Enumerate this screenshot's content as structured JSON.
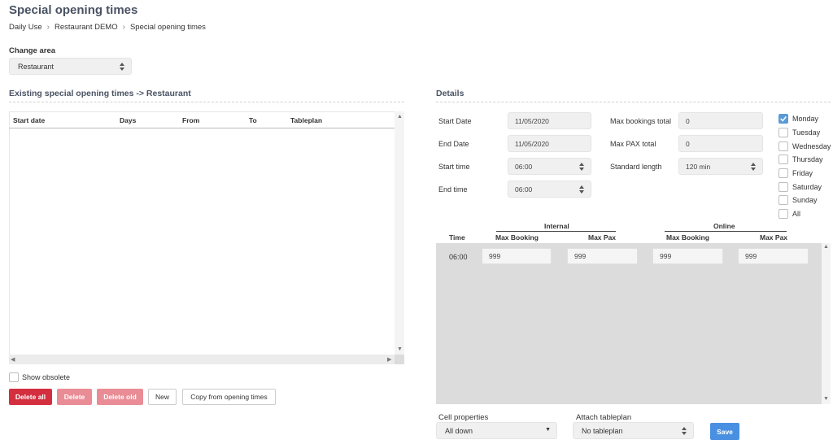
{
  "page_title": "Special opening times",
  "breadcrumb": [
    "Daily Use",
    "Restaurant DEMO",
    "Special opening times"
  ],
  "change_area": {
    "label": "Change area",
    "value": "Restaurant"
  },
  "existing": {
    "title": "Existing special opening times -> Restaurant",
    "columns": [
      "Start date",
      "Days",
      "From",
      "To",
      "Tableplan"
    ],
    "rows": [],
    "show_obsolete_label": "Show obsolete",
    "show_obsolete_checked": false,
    "buttons": {
      "delete_all": "Delete all",
      "delete": "Delete",
      "delete_old": "Delete old",
      "new": "New",
      "copy": "Copy from opening times"
    }
  },
  "details": {
    "title": "Details",
    "start_date": {
      "label": "Start Date",
      "value": "11/05/2020"
    },
    "end_date": {
      "label": "End Date",
      "value": "11/05/2020"
    },
    "start_time": {
      "label": "Start time",
      "value": "06:00"
    },
    "end_time": {
      "label": "End time",
      "value": "06:00"
    },
    "max_bookings_total": {
      "label": "Max bookings total",
      "value": "0"
    },
    "max_pax_total": {
      "label": "Max PAX total",
      "value": "0"
    },
    "standard_length": {
      "label": "Standard length",
      "value": "120 min"
    },
    "days": [
      {
        "label": "Monday",
        "checked": true
      },
      {
        "label": "Tuesday",
        "checked": false
      },
      {
        "label": "Wednesday",
        "checked": false
      },
      {
        "label": "Thursday",
        "checked": false
      },
      {
        "label": "Friday",
        "checked": false
      },
      {
        "label": "Saturday",
        "checked": false
      },
      {
        "label": "Sunday",
        "checked": false
      },
      {
        "label": "All",
        "checked": false
      }
    ],
    "grid": {
      "internal_label": "Internal",
      "online_label": "Online",
      "time_header": "Time",
      "max_booking_header": "Max Booking",
      "max_pax_header": "Max Pax",
      "rows": [
        {
          "time": "06:00",
          "int_booking": "999",
          "int_pax": "999",
          "onl_booking": "999",
          "onl_pax": "999"
        }
      ]
    },
    "cell_properties": {
      "label": "Cell properties",
      "value": "All down"
    },
    "attach_tableplan": {
      "label": "Attach tableplan",
      "value": "No tableplan"
    },
    "save_label": "Save"
  },
  "colors": {
    "accent_blue": "#4a90e2",
    "danger_red": "#d32f3f",
    "danger_disabled": "#e98c95",
    "grid_bg": "#dcdcdc"
  }
}
